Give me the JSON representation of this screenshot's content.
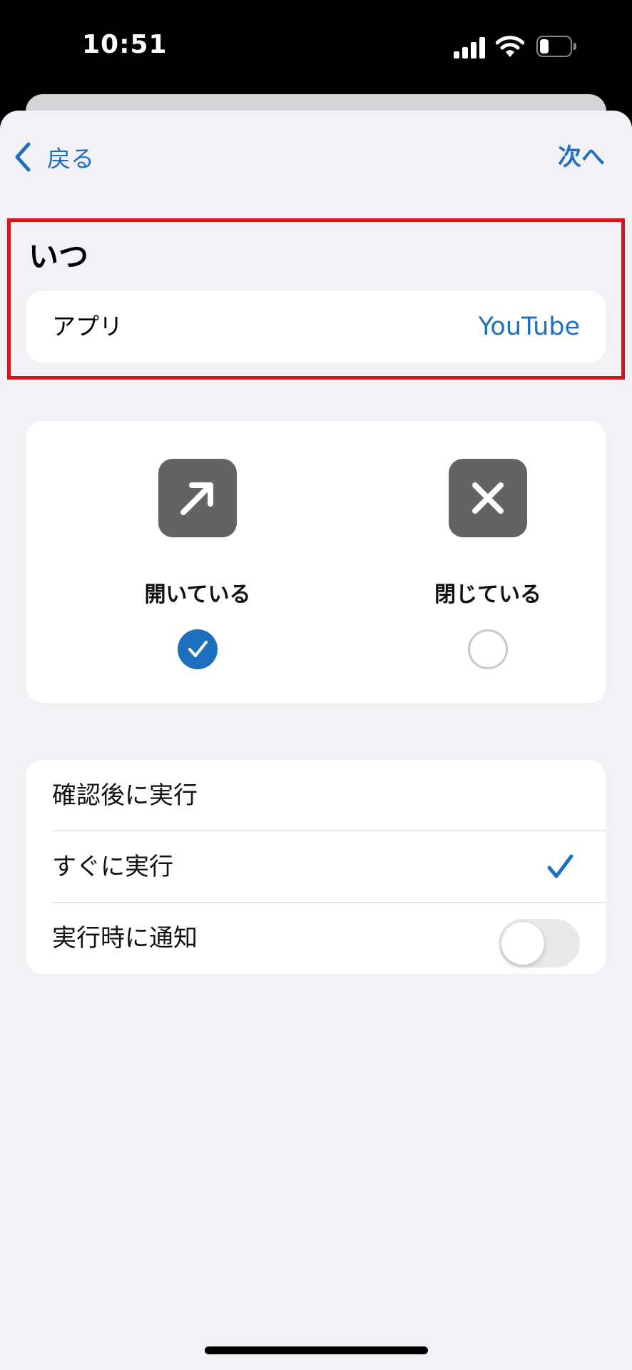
{
  "status_bar": {
    "time": "10:51",
    "icons": [
      "cellular-signal-icon",
      "wifi-icon",
      "battery-icon"
    ]
  },
  "nav": {
    "back_label": "戻る",
    "next_label": "次へ"
  },
  "when_section": {
    "title": "いつ",
    "app_label": "アプリ",
    "app_value": "YouTube"
  },
  "app_state": {
    "options": [
      {
        "label": "開いている",
        "icon": "arrow-up-right-icon",
        "selected": true
      },
      {
        "label": "閉じている",
        "icon": "close-x-icon",
        "selected": false
      }
    ]
  },
  "run_options": {
    "items": [
      {
        "label": "確認後に実行",
        "selected": false
      },
      {
        "label": "すぐに実行",
        "selected": true
      },
      {
        "label": "実行時に通知",
        "toggle": false
      }
    ]
  },
  "colors": {
    "accent": "#1f6fbf",
    "highlight_border": "#d7141a",
    "icon_box": "#636366",
    "sheet_background": "#f2f2f6"
  }
}
